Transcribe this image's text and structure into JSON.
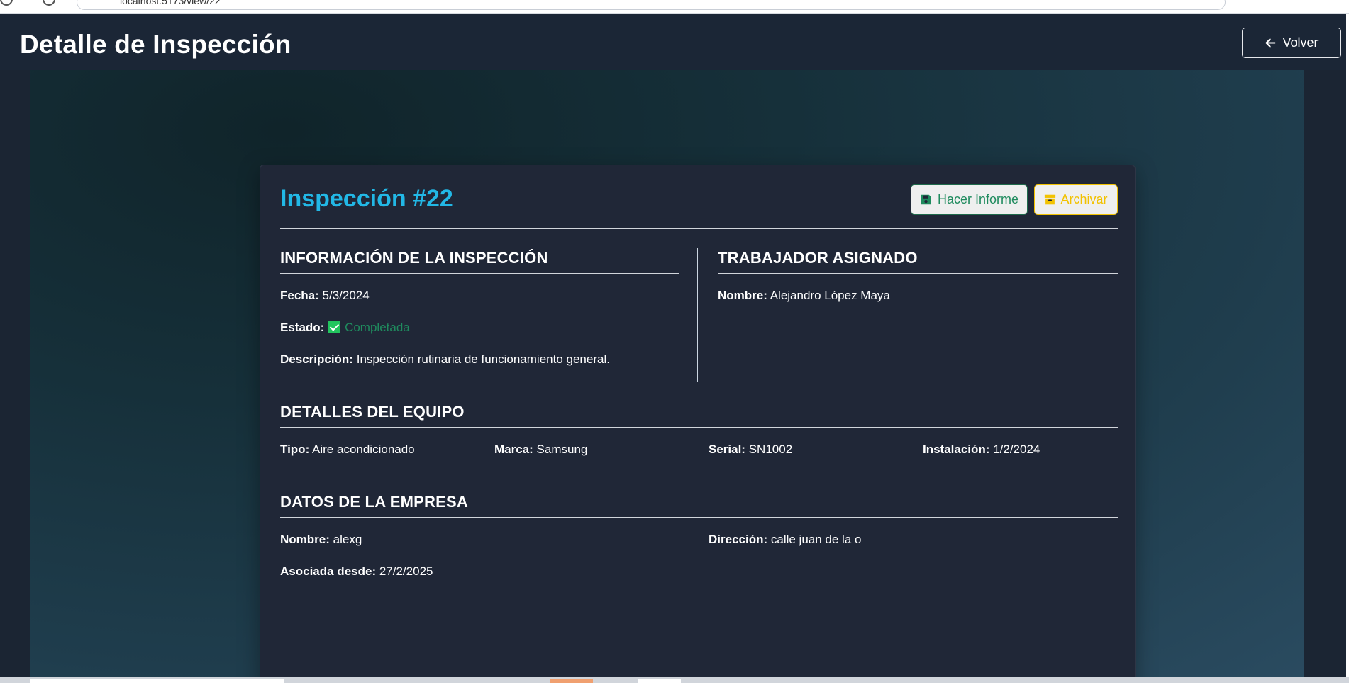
{
  "browser": {
    "url_text": "localhost:5173/view/22"
  },
  "header": {
    "title": "Detalle de Inspección",
    "back_label": "Volver"
  },
  "inspection": {
    "title": "Inspección #22",
    "actions": {
      "report_label": "Hacer Informe",
      "archive_label": "Archivar"
    },
    "info": {
      "heading": "INFORMACIÓN DE LA INSPECCIÓN",
      "date_label": "Fecha:",
      "date_value": "5/3/2024",
      "status_label": "Estado:",
      "status_value": "Completada",
      "description_label": "Descripción:",
      "description_value": "Inspección rutinaria de funcionamiento general."
    },
    "worker": {
      "heading": "TRABAJADOR ASIGNADO",
      "name_label": "Nombre:",
      "name_value": "Alejandro López Maya"
    },
    "equipment": {
      "heading": "DETALLES DEL EQUIPO",
      "type_label": "Tipo:",
      "type_value": "Aire acondicionado",
      "brand_label": "Marca:",
      "brand_value": "Samsung",
      "serial_label": "Serial:",
      "serial_value": "SN1002",
      "install_label": "Instalación:",
      "install_value": "1/2/2024"
    },
    "company": {
      "heading": "DATOS DE LA EMPRESA",
      "name_label": "Nombre:",
      "name_value": "alexg",
      "address_label": "Dirección:",
      "address_value": "calle juan de la o",
      "since_label": "Asociada desde:",
      "since_value": "27/2/2025"
    }
  },
  "colors": {
    "accent": "#22b8e6",
    "success": "#1f8b5e",
    "warning": "#f2c200",
    "card_bg": "#202737"
  },
  "icons": {
    "back": "arrow-left-icon",
    "report": "floppy-disk-icon",
    "archive": "archive-box-icon",
    "status": "check-square-icon"
  }
}
